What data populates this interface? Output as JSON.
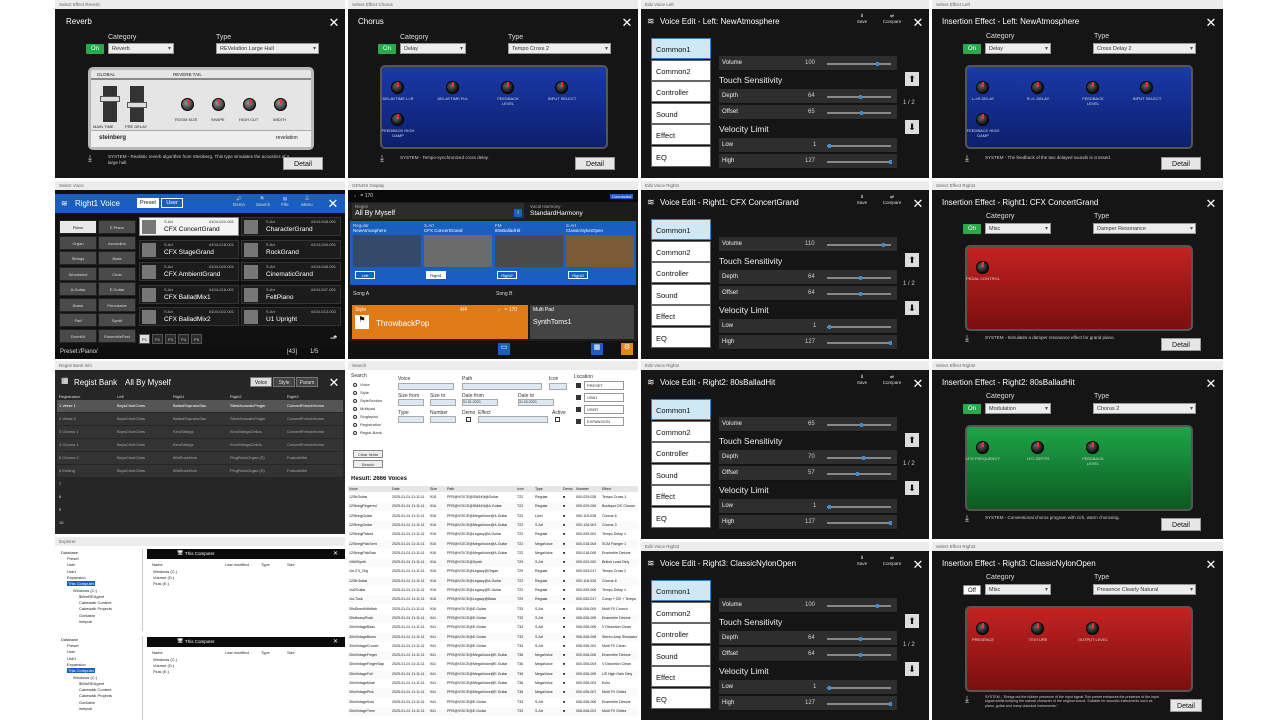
{
  "colors": {
    "blue": "#1a5fbf",
    "green": "#2aa84a",
    "accent": "#0b8ad6"
  },
  "common": {
    "category": "Category",
    "type": "Type",
    "on": "On",
    "off": "Off",
    "detail": "Detail",
    "save": "Save",
    "compare": "Compare",
    "page": "1 / 2",
    "volume": "Volume",
    "touch": "Touch Sensitivity",
    "depth": "Depth",
    "offset": "Offset",
    "velocity": "Velocity Limit",
    "low": "Low",
    "high": "High",
    "nav": [
      "Common1",
      "Common2",
      "Controller",
      "Sound",
      "Effect",
      "EQ"
    ],
    "download_icon": "download-icon",
    "close_icon": "close-icon"
  },
  "reverb": {
    "strip": "Select Effect Reverb",
    "title": "Reverb",
    "category": "Reverb",
    "type": "REVelation Large Hall",
    "global": "GLOBAL",
    "tail": "REVERB TAIL",
    "main_time": "MAIN TIME",
    "pre_delay": "PRE DELAY",
    "room": "ROOM SIZE",
    "shape": "SHAPE",
    "hicut": "HIGH CUT",
    "width": "WIDTH",
    "brand": "steinberg",
    "logo": "revelation",
    "desc": "SYSTEM - Realistic reverb algorithm from Steinberg. This type simulates the acoustics of a large hall."
  },
  "chorus": {
    "strip": "Select Effect Chorus",
    "title": "Chorus",
    "category": "Delay",
    "type": "Tempo Cross 2",
    "knobs": [
      "DELAYTIME L>R",
      "DELAYTIME R>L",
      "FEEDBACK LEVEL",
      "INPUT SELECT"
    ],
    "fb": "FEEDBACK HIGH DAMP",
    "desc": "SYSTEM - Tempo-synchronized cross delay."
  },
  "veLeft": {
    "strip": "Edit Voice Left",
    "title": "Voice Edit  -  Left: NewAtmosphere",
    "vol": "100",
    "depth": "64",
    "offset": "65",
    "low": "1",
    "high": "127"
  },
  "ieLeft": {
    "strip": "Select Effect Left",
    "title": "Insertion Effect - Left: NewAtmosphere",
    "category": "Delay",
    "type": "Cross Delay 2",
    "knobs": [
      "L->R DELAY",
      "R->L DELAY",
      "FEEDBACK LEVEL",
      "INPUT SELECT"
    ],
    "fb": "FEEDBACK HIGH DAMP",
    "desc": "SYSTEM - The feedback of the two delayed sounds is crossed."
  },
  "sv": {
    "strip": "Select Voice",
    "title": "Right1 Voice",
    "preset": "Preset",
    "user": "User",
    "tools": [
      "Demo",
      "Search",
      "File",
      "Menu"
    ],
    "cats": [
      "Piano",
      "E.Piano",
      "Organ",
      "Accordion",
      "Strings",
      "Bass",
      "Woodwind",
      "Choir",
      "A.Guitar",
      "E.Guitar",
      "Brass",
      "Percussive",
      "Pad",
      "Synth",
      "DrumKit",
      "EnsembleFast"
    ],
    "voices": [
      {
        "s1": "S.Art",
        "s3": "#104-021-001",
        "n": "CFX ConcertGrand"
      },
      {
        "s1": "S.Art",
        "s3": "#104-048-001",
        "n": "CharacterGrand"
      },
      {
        "s1": "S.Art",
        "s3": "#104-018-001",
        "n": "CFX StageGrand"
      },
      {
        "s1": "S.Art",
        "s3": "#104-049-001",
        "n": "RockGrand"
      },
      {
        "s1": "S.Art",
        "s3": "#104-020-001",
        "n": "CFX AmbientGrand"
      },
      {
        "s1": "S.Art",
        "s3": "#104-048-001",
        "n": "CinematicGrand"
      },
      {
        "s1": "S.Art",
        "s3": "#104-016-001",
        "n": "CFX BalladMix1"
      },
      {
        "s1": "S.Art",
        "s3": "#104-047-001",
        "n": "FeltPiano"
      },
      {
        "s1": "S.Art",
        "s3": "#104-022-001",
        "n": "CFX BalladMix2"
      },
      {
        "s1": "S.Art",
        "s3": "#104-013-002",
        "n": "U1 Upright"
      }
    ],
    "pages": [
      "P1",
      "P2",
      "P3",
      "P4",
      "P5"
    ],
    "path": "Preset:/Piano/",
    "count": "[43]",
    "pager": "1/5"
  },
  "dp": {
    "strip": "GENOS Display",
    "tempo": "♩ = 170",
    "connected": "Connected",
    "regist_label": "Regist",
    "regist": "All By Myself",
    "vh_label": "Vocal Harmony",
    "vh": "StandardHarmony",
    "parts": [
      {
        "k": "Regular",
        "n": "NewAtmosphere",
        "p": "Left"
      },
      {
        "k": "S.Art",
        "n": "CFX ConcertGrand",
        "p": "Right1"
      },
      {
        "k": "FM",
        "n": "80sBalladHit",
        "p": "Right2"
      },
      {
        "k": "S.Art",
        "n": "ClassicNylonOpen",
        "p": "Right3"
      }
    ],
    "songA": "Song A",
    "songB": "Song B",
    "style_label": "Style",
    "meter": "4/4",
    "style_tempo": "♩ = 170",
    "style": "ThrowbackPop",
    "mp_label": "Multi Pad",
    "mp": "SynthToms1"
  },
  "ve1": {
    "strip": "Edit Voice Right1",
    "title": "Voice Edit  -  Right1: CFX ConcertGrand",
    "vol": "110",
    "depth": "64",
    "offset": "64",
    "low": "1",
    "high": "127"
  },
  "ie1": {
    "strip": "Select Effect Right1",
    "title": "Insertion Effect - Right1: CFX ConcertGrand",
    "category": "Misc",
    "type": "Damper Resonance",
    "knobs": [
      "PEDAL CONTROL"
    ],
    "desc": "SYSTEM - Simulates a damper resonance effect for grand piano."
  },
  "rb": {
    "strip": "Regist Bank Info",
    "title": "Regist Bank",
    "name": "All By Myself",
    "tabs": [
      "Voice",
      "Style",
      "Param"
    ],
    "cols": [
      "Registration",
      "Left",
      "Right1",
      "Right2",
      "Right3"
    ],
    "rows": [
      [
        "1 Verse 1",
        "BoysChoirOohs",
        "BalladSopranoSax",
        "SteelAcousticFinger",
        "ConcertFrenchHorns"
      ],
      [
        "2 Verse 2",
        "BoysChoirOohs",
        "BalladSopranoSax",
        "SteelAcousticFinger",
        "ConcertFrenchHorns"
      ],
      [
        "3 Chorus 1",
        "BoysChoirOohs",
        "KinoStrings",
        "KinoStringsCellos",
        "ConcertFrenchHorns"
      ],
      [
        "4 Chorus 1",
        "BoysChoirOohs",
        "KinoStrings",
        "KinoStringsCellos",
        "ConcertFrenchHorns"
      ],
      [
        "5 Chorus 2",
        "BoysChoirOohs",
        "80sRockHorn",
        "PingRockOrgan (S)",
        "FusionWire"
      ],
      [
        "6 Ending",
        "BoysChoirOohs",
        "80sRockHorn",
        "PingRockOrgan (S)",
        "FusionWire"
      ]
    ],
    "nums": [
      "7",
      "8",
      "9",
      "10"
    ]
  },
  "sr": {
    "strip": "Search",
    "search": "Search",
    "opts": [
      "Voice",
      "Style",
      "StyleSection",
      "Multipad",
      "Singlepad",
      "Registration",
      "Regist-Bank"
    ],
    "f": {
      "voice": "Voice",
      "path": "Path",
      "icon": "Icon",
      "size_from": "Size from",
      "size_to": "Size to",
      "date_from": "Date from",
      "date_to": "Date to",
      "type": "Type",
      "number": "Number",
      "demo": "Demo",
      "effect": "Effect",
      "active": "Active",
      "location": "Location",
      "d1": "01.01.2020",
      "d2": "31.03.2020"
    },
    "locs": [
      "PRESET",
      "USB1",
      "USER",
      "EXPANSION"
    ],
    "clear": "Clear fields",
    "search_btn": "Search",
    "result": "Result: 2666 Voices",
    "cols": [
      "Voice",
      "Date",
      "Size",
      "Path",
      "Icon",
      "Type",
      "Demo",
      "Number",
      "Effect"
    ],
    "rows": [
      [
        "12StrGuitar",
        "2025-01-01 11:11:11",
        "918",
        "PRS@VOICE@SM&Kit@Guitar",
        "T22",
        "Regular",
        "■",
        "000-029-028",
        "Tempo Cross 1"
      ],
      [
        "12StringFingered",
        "2025-01-01 11:11:11",
        "916",
        "PRS@VOICE@SM&Kit@A.Guitar",
        "T22",
        "Regular",
        "■",
        "000-029-026",
        "Boutique DC Chorus"
      ],
      [
        "12StringGuitar",
        "2025-01-01 11:11:11",
        "916",
        "PRS@VOICE@MegaVoice@A.Guitar",
        "T22",
        "Live!",
        "■",
        "000-119-028",
        "Chorus 6"
      ],
      [
        "12StringGuitar",
        "2025-01-01 11:11:11",
        "916",
        "PRS@VOICE@MegaVoice@A.Guitar",
        "T22",
        "S.Art",
        "■",
        "000-126-001",
        "Chorus 3"
      ],
      [
        "12StringPicked",
        "2025-01-01 11:11:11",
        "916",
        "PRS@VOICE@Legacy@A.Guitar",
        "T22",
        "Regular",
        "■",
        "000-009-002",
        "Tempo Delay 1"
      ],
      [
        "12StringPickSeml",
        "2025-01-01 11:11:11",
        "916",
        "PRS@VOICE@MegaVoice@A.Guitar",
        "T22",
        "MegaVoice",
        "■",
        "000-016-004",
        "SCM Flanger 1"
      ],
      [
        "12StringPickSws",
        "2025-01-01 11:11:11",
        "916",
        "PRS@VOICE@MegaVoice@A.Guitar",
        "T22",
        "MegaVoice",
        "■",
        "000-016-006",
        "Ensemble Detune"
      ],
      [
        "1969Synth",
        "2025-01-01 11:11:11",
        "916",
        "PRS@VOICE@Synth",
        "T29",
        "S.Art",
        "■",
        "000-003-020",
        "British Lead Dirty"
      ],
      [
        "1In-2'3_Org",
        "2025-01-01 11:11:11",
        "916",
        "PRS@VOICE@Legacy@Organ",
        "T29",
        "Regular",
        "■",
        "000-003-017",
        "Tempo Cross 2"
      ],
      [
        "12StrGuitar",
        "2025-01-01 11:11:11",
        "916",
        "PRS@VOICE@Legacy@A.Guitar",
        "T22",
        "Regular",
        "■",
        "000-118-026",
        "Chorus 6"
      ],
      [
        "1st2Guitar",
        "2025-01-01 11:11:11",
        "916",
        "PRS@VOICE@Legacy@E.Guitar",
        "T22",
        "Regular",
        "■",
        "000-009-006",
        "Tempo Delay 1"
      ],
      [
        "1st-Tusk",
        "2025-01-01 11:11:11",
        "916",
        "PRS@VOICE@Legacy@Bass",
        "T29",
        "Regular",
        "■",
        "000-030-017",
        "Comp + OD + Tempo"
      ],
      [
        "30sDirectNthWah",
        "2025-01-01 11:11:11",
        "916",
        "PRS@VOICE@E.Guitar",
        "T33",
        "S.Art",
        "■",
        "006-006-009",
        "Multi FX Crunch"
      ],
      [
        "30sHeavyRock",
        "2025-01-01 11:11:11",
        "941",
        "PRS@VOICE@E.Guitar",
        "T33",
        "S.Art",
        "■",
        "006-006-005",
        "Ensemble Detune"
      ],
      [
        "30sVintageBass",
        "2025-01-01 11:11:11",
        "941",
        "PRS@VOICE@E.Guitar",
        "T33",
        "S.Art",
        "■",
        "006-006-006",
        "V Distortion Clean"
      ],
      [
        "30sVintageBlues",
        "2025-01-01 11:11:11",
        "941",
        "PRS@VOICE@E.Guitar",
        "T33",
        "S.Art",
        "■",
        "006-006-008",
        "Stereo Amp Simulator"
      ],
      [
        "30sVintageCrunch",
        "2025-01-01 11:11:11",
        "941",
        "PRS@VOICE@E.Guitar",
        "T33",
        "S.Art",
        "■",
        "006-006-002",
        "Multi FX Clean"
      ],
      [
        "30sVintageFinger",
        "2025-01-01 11:11:11",
        "941",
        "PRS@VOICE@MegaVoice@E.Guitar",
        "T36",
        "MegaVoice",
        "■",
        "000-006-006",
        "Ensemble Detune"
      ],
      [
        "30sVintageFingerSlap",
        "2025-01-01 11:11:11",
        "941",
        "PRS@VOICE@MegaVoice@E.Guitar",
        "T36",
        "MegaVoice",
        "■",
        "000-006-004",
        "V Distortion Clean"
      ],
      [
        "30sVintageFull",
        "2025-01-01 11:11:11",
        "941",
        "PRS@VOICE@MegaVoice@E.Guitar",
        "T36",
        "MegaVoice",
        "■",
        "000-006-005",
        "US High Gain Dirty"
      ],
      [
        "30sVintageMute",
        "2025-01-01 11:11:11",
        "941",
        "PRS@VOICE@MegaVoice@E.Guitar",
        "T36",
        "MegaVoice",
        "■",
        "000-006-003",
        "Echo"
      ],
      [
        "30sVintagePick",
        "2025-01-01 11:11:11",
        "941",
        "PRS@VOICE@MegaVoice@E.Guitar",
        "T36",
        "MegaVoice",
        "■",
        "000-006-007",
        "Multi FX Oldies"
      ],
      [
        "30sVintageSolo",
        "2025-01-01 11:11:11",
        "941",
        "PRS@VOICE@E.Guitar",
        "T33",
        "S.Art",
        "■",
        "006-006-006",
        "Ensemble Detune"
      ],
      [
        "30sVintageTrem",
        "2025-01-01 11:11:11",
        "941",
        "PRS@VOICE@E.Guitar",
        "T33",
        "S.Art",
        "■",
        "006-006-003",
        "Multi FX Oldies"
      ]
    ]
  },
  "ve2": {
    "strip": "Edit Voice Right2",
    "title": "Voice Edit  -  Right2: 80sBalladHit",
    "vol": "65",
    "depth": "70",
    "offset": "57",
    "low": "1",
    "high": "127"
  },
  "ie2": {
    "strip": "Select Effect Right2",
    "title": "Insertion Effect - Right2: 80sBalladHit",
    "category": "Modulation",
    "type": "Chorus 2",
    "knobs": [
      "LFO FREQUENCY",
      "LFO DEPTH",
      "FEEDBACK LEVEL"
    ],
    "desc": "SYSTEM - Conventional chorus program with rich, warm chorusing."
  },
  "ex1": {
    "strip": "Explorer",
    "title": "This Computer",
    "root": "Database",
    "tree": [
      "Preset",
      "User",
      "Usb1",
      "Expansion",
      "This Computer",
      "Windows (C:)",
      "$WinREAgent",
      "Cakewalk Content",
      "Cakewalk Projects",
      "Gorilabin",
      "inetpub"
    ],
    "cols": [
      "Name",
      "Last modified",
      "Type",
      "Size"
    ],
    "files": [
      "Windows (C:)",
      "Volume (D:)",
      "Flusi (E:)"
    ]
  },
  "ve3": {
    "strip": "Edit Voice Right3",
    "title": "Voice Edit  -  Right3: ClassicNylonOpen",
    "vol": "100",
    "depth": "64",
    "offset": "64",
    "low": "1",
    "high": "127"
  },
  "ie3": {
    "strip": "Select Effect Right3",
    "title": "Insertion Effect - Right3: ClassicNylonOpen",
    "category": "Misc",
    "type": "Presence Clearly Natural",
    "knobs": [
      "PRESENCE",
      "TEXTURE",
      "OUTPUT LEVEL"
    ],
    "desc": "SYSTEM - \"Brings out the hidden presence of the input signal.This preset enhances the presence of the input signal whilst keeping the natural character of the original sound. Suitable for acoustic instruments such as piano, guitar and many classical instruments.\""
  }
}
